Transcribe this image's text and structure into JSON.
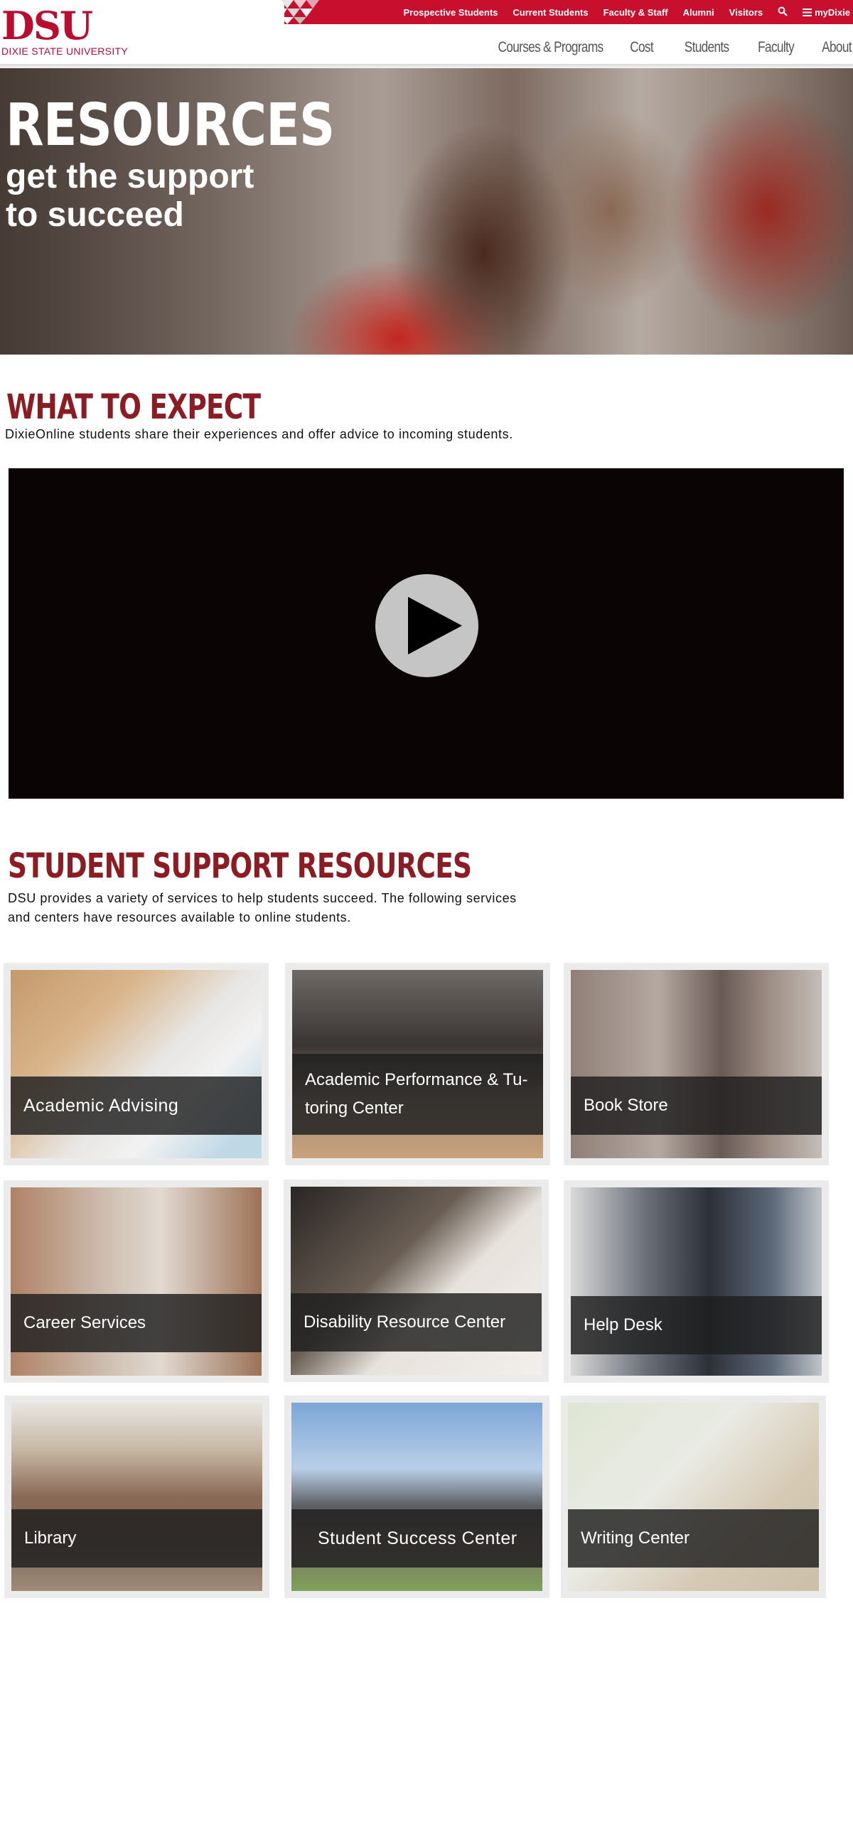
{
  "brand": {
    "logo_mark": "DSU",
    "logo_text": "DIXIE STATE UNIVERSITY",
    "primary_color": "#c8102e",
    "heading_color": "#8b1c24"
  },
  "topbar": {
    "links": [
      "Prospective Students",
      "Current Students",
      "Faculty & Staff",
      "Alumni",
      "Visitors"
    ],
    "mydixie_label": "myDixie"
  },
  "mainnav": {
    "items": [
      "Courses & Programs",
      "Cost",
      "Students",
      "Faculty",
      "About"
    ]
  },
  "hero": {
    "title": "RESOURCES",
    "subtitle_line1": "get the support",
    "subtitle_line2": "to succeed"
  },
  "expect": {
    "title": "WHAT TO EXPECT",
    "text": "DixieOnline students share their experiences and offer advice to incoming students."
  },
  "support": {
    "title": "STUDENT SUPPORT RESOURCES",
    "text_line1": "DSU provides a variety of services to help students succeed. The following services",
    "text_line2": "and centers have resources available to online students."
  },
  "cards": [
    {
      "label": "Academic Advising"
    },
    {
      "label": "Academic Performance & Tu-"
    },
    {
      "label": "toring Center"
    },
    {
      "label": "Book Store"
    },
    {
      "label": "Career Services"
    },
    {
      "label": "Disability Resource Center"
    },
    {
      "label": "Help Desk"
    },
    {
      "label": "Library"
    },
    {
      "label": "Student Success Center"
    },
    {
      "label": "Writing Center"
    }
  ]
}
